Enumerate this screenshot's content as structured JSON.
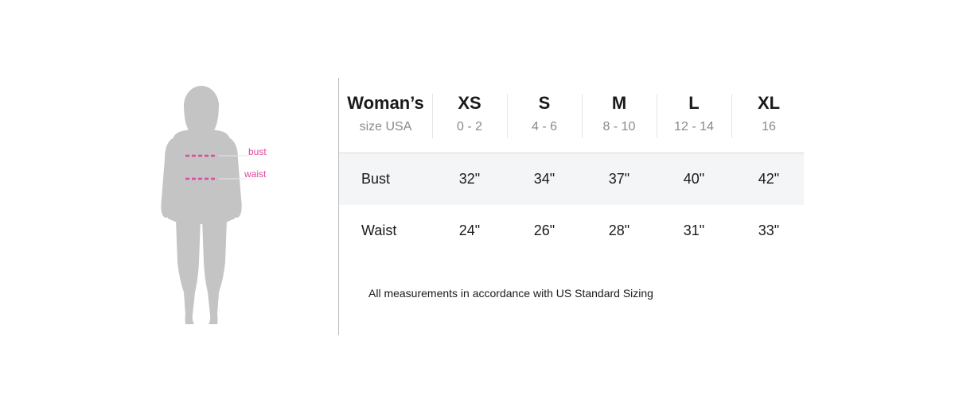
{
  "figure": {
    "bust_label": "bust",
    "waist_label": "waist",
    "silhouette_color": "#c4c4c4",
    "marker_color": "#e0479e"
  },
  "table": {
    "header": {
      "title": "Woman’s",
      "subtitle": "size USA"
    },
    "sizes": [
      {
        "label": "XS",
        "range": "0 - 2"
      },
      {
        "label": "S",
        "range": "4 - 6"
      },
      {
        "label": "M",
        "range": "8 - 10"
      },
      {
        "label": "L",
        "range": "12 - 14"
      },
      {
        "label": "XL",
        "range": "16"
      }
    ],
    "rows": [
      {
        "label": "Bust",
        "values": [
          "32\"",
          "34\"",
          "37\"",
          "40\"",
          "42\""
        ]
      },
      {
        "label": "Waist",
        "values": [
          "24\"",
          "26\"",
          "28\"",
          "31\"",
          "33\""
        ]
      }
    ]
  },
  "footnote": "All measurements in accordance with US Standard Sizing"
}
